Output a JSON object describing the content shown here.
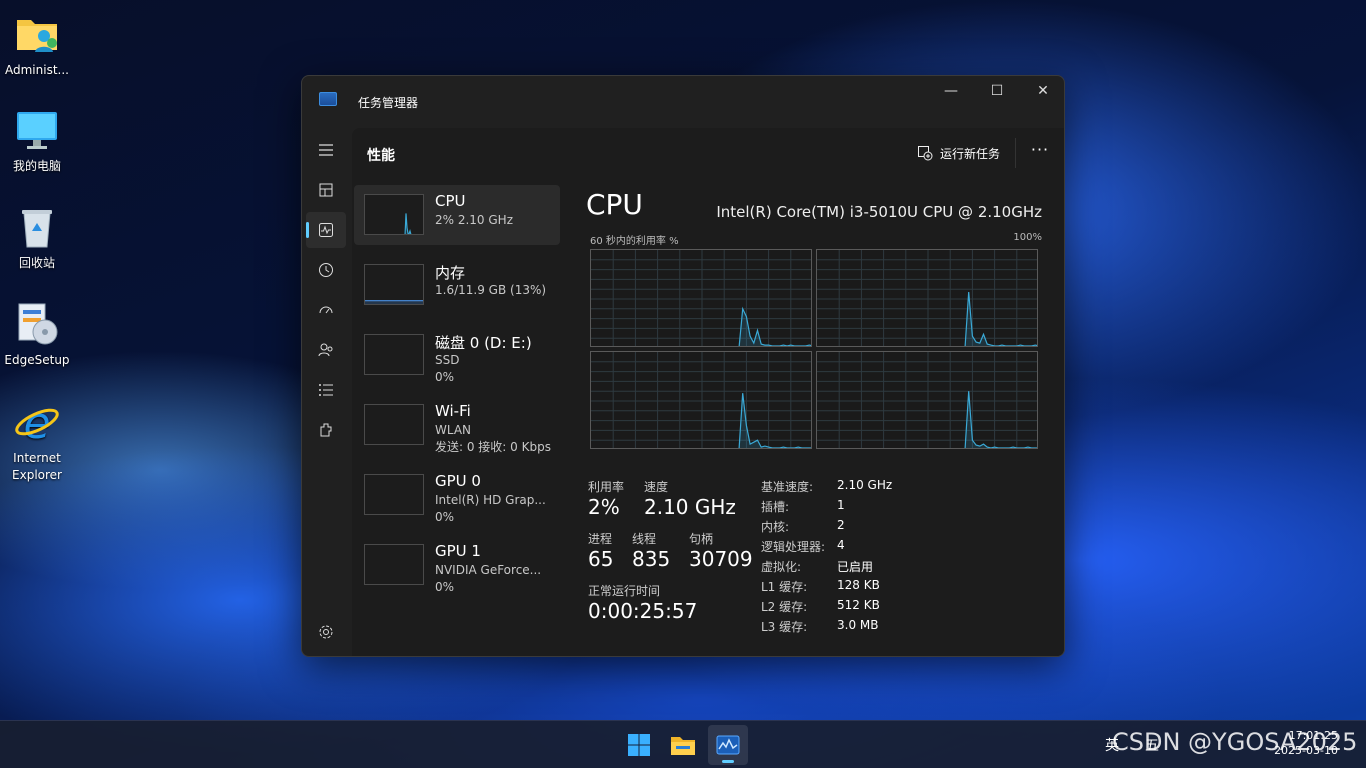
{
  "desktop": {
    "icons": [
      {
        "label": "Administ...",
        "icon": "user-folder-icon"
      },
      {
        "label": "我的电脑",
        "icon": "computer-icon"
      },
      {
        "label": "回收站",
        "icon": "recycle-bin-icon"
      },
      {
        "label": "EdgeSetup",
        "icon": "installer-icon"
      },
      {
        "label": "Internet\nExplorer",
        "icon": "internet-explorer-icon"
      }
    ]
  },
  "window": {
    "title": "任务管理器",
    "controls": {
      "minimize": "—",
      "maximize": "☐",
      "close": "✕"
    }
  },
  "nav": [
    {
      "icon": "hamburger-menu-icon"
    },
    {
      "icon": "processes-icon"
    },
    {
      "icon": "performance-icon",
      "active": true
    },
    {
      "icon": "app-history-icon"
    },
    {
      "icon": "startup-apps-icon"
    },
    {
      "icon": "users-icon"
    },
    {
      "icon": "details-icon"
    },
    {
      "icon": "services-icon"
    },
    {
      "icon": "settings-icon"
    }
  ],
  "panel": {
    "title": "性能",
    "run_task": "运行新任务",
    "more": "···"
  },
  "devices": [
    {
      "name": "CPU",
      "sub1": "2% 2.10 GHz",
      "sub2": "",
      "sub3": "",
      "selected": true
    },
    {
      "name": "内存",
      "sub1": "1.6/11.9 GB (13%)",
      "sub2": "",
      "sub3": ""
    },
    {
      "name": "磁盘 0 (D: E:)",
      "sub1": "SSD",
      "sub2": "0%",
      "sub3": ""
    },
    {
      "name": "Wi-Fi",
      "sub1": "WLAN",
      "sub2": "发送: 0 接收: 0 Kbps",
      "sub3": ""
    },
    {
      "name": "GPU 0",
      "sub1": "Intel(R) HD Grap...",
      "sub2": "0%",
      "sub3": ""
    },
    {
      "name": "GPU 1",
      "sub1": "NVIDIA GeForce...",
      "sub2": "0%",
      "sub3": ""
    }
  ],
  "cpu": {
    "heading": "CPU",
    "model": "Intel(R) Core(TM) i3-5010U CPU @ 2.10GHz",
    "graph_label": "60 秒内的利用率 %",
    "graph_max": "100%",
    "graphs": [
      {
        "name": "logical-processor-0",
        "points": [
          0,
          0,
          0,
          0,
          0,
          0,
          0,
          0,
          0,
          0,
          0,
          0,
          0,
          0,
          0,
          0,
          0,
          0,
          0,
          0,
          0,
          0,
          0,
          0,
          0,
          0,
          0,
          0,
          0,
          0,
          0,
          0,
          0,
          0,
          0,
          0,
          0,
          0,
          0,
          0,
          0,
          0,
          0,
          0,
          0,
          0,
          0,
          0,
          0,
          0,
          0,
          0,
          0,
          0,
          0,
          0,
          0,
          0,
          0,
          0,
          0,
          0,
          0,
          0,
          0,
          0,
          0,
          0,
          0,
          0,
          0,
          0,
          0,
          0,
          0,
          0,
          0,
          0,
          0,
          0,
          0,
          0,
          0,
          0,
          0,
          0,
          0,
          0,
          0,
          0,
          0,
          0,
          0,
          0,
          0,
          0,
          0,
          0,
          0,
          0,
          0,
          0,
          0,
          0,
          0,
          0,
          0,
          0,
          0,
          0,
          0,
          0,
          0,
          0,
          0,
          0,
          0,
          0,
          0,
          0,
          0,
          0,
          0,
          0,
          0,
          0,
          0,
          0,
          0,
          0,
          0,
          0,
          0,
          0,
          0,
          0,
          0,
          0,
          0,
          0,
          0,
          0,
          0,
          0,
          0,
          0,
          0,
          0,
          0,
          0,
          0,
          0,
          0,
          0,
          0,
          0,
          0,
          0,
          0,
          0,
          0,
          0,
          0,
          0,
          0,
          0,
          0,
          0,
          0,
          0,
          0,
          0,
          0,
          0,
          0,
          0,
          0,
          0,
          0,
          0,
          0,
          0,
          0,
          0,
          0,
          0,
          0,
          0,
          0,
          0,
          0,
          0,
          0,
          0,
          0,
          0,
          0,
          0,
          0,
          0,
          0,
          0,
          0,
          0,
          0,
          0,
          0,
          0,
          0,
          0,
          0,
          0,
          0,
          0,
          0,
          0,
          0,
          0,
          0,
          0,
          0,
          0,
          0,
          0,
          0,
          0
        ]
      },
      {
        "name": "logical-processor-1"
      },
      {
        "name": "logical-processor-2"
      },
      {
        "name": "logical-processor-3"
      }
    ],
    "series": [
      [
        0,
        0,
        0,
        0,
        0,
        0,
        0,
        0,
        0,
        0,
        0,
        0,
        0,
        0,
        0,
        0,
        0,
        0,
        0,
        0,
        0,
        0,
        0,
        0,
        0,
        0,
        0,
        0,
        0,
        0,
        0,
        0,
        0,
        0,
        0,
        0,
        0,
        0,
        0,
        0,
        0,
        40,
        32,
        12,
        5,
        18,
        4,
        3,
        3,
        2,
        2,
        2,
        3,
        2,
        3,
        2,
        2,
        2,
        2,
        3,
        2
      ],
      [
        0,
        0,
        0,
        0,
        0,
        0,
        0,
        0,
        0,
        0,
        0,
        0,
        0,
        0,
        0,
        0,
        0,
        0,
        0,
        0,
        0,
        0,
        0,
        0,
        0,
        0,
        0,
        0,
        0,
        0,
        0,
        0,
        0,
        0,
        0,
        0,
        0,
        0,
        0,
        0,
        0,
        57,
        12,
        6,
        5,
        14,
        4,
        3,
        2,
        2,
        3,
        2,
        2,
        2,
        2,
        3,
        2,
        2,
        2,
        3,
        2
      ],
      [
        0,
        0,
        0,
        0,
        0,
        0,
        0,
        0,
        0,
        0,
        0,
        0,
        0,
        0,
        0,
        0,
        0,
        0,
        0,
        0,
        0,
        0,
        0,
        0,
        0,
        0,
        0,
        0,
        0,
        0,
        0,
        0,
        0,
        0,
        0,
        0,
        0,
        0,
        0,
        0,
        0,
        58,
        25,
        6,
        8,
        10,
        3,
        4,
        3,
        2,
        2,
        2,
        3,
        2,
        2,
        2,
        3,
        2,
        2,
        2,
        2
      ],
      [
        0,
        0,
        0,
        0,
        0,
        0,
        0,
        0,
        0,
        0,
        0,
        0,
        0,
        0,
        0,
        0,
        0,
        0,
        0,
        0,
        0,
        0,
        0,
        0,
        0,
        0,
        0,
        0,
        0,
        0,
        0,
        0,
        0,
        0,
        0,
        0,
        0,
        0,
        0,
        0,
        0,
        60,
        10,
        5,
        4,
        6,
        3,
        2,
        3,
        2,
        2,
        2,
        2,
        3,
        2,
        2,
        2,
        3,
        2,
        2,
        2
      ]
    ],
    "stats": {
      "util_label": "利用率",
      "util_value": "2%",
      "speed_label": "速度",
      "speed_value": "2.10 GHz",
      "proc_label": "进程",
      "proc_value": "65",
      "thread_label": "线程",
      "thread_value": "835",
      "handle_label": "句柄",
      "handle_value": "30709",
      "uptime_label": "正常运行时间",
      "uptime_value": "0:00:25:57"
    },
    "specs": [
      {
        "k": "基准速度:",
        "v": "2.10 GHz"
      },
      {
        "k": "插槽:",
        "v": "1"
      },
      {
        "k": "内核:",
        "v": "2"
      },
      {
        "k": "逻辑处理器:",
        "v": "4"
      },
      {
        "k": "虚拟化:",
        "v": "已启用"
      },
      {
        "k": "L1 缓存:",
        "v": "128 KB"
      },
      {
        "k": "L2 缓存:",
        "v": "512 KB"
      },
      {
        "k": "L3 缓存:",
        "v": "3.0 MB"
      }
    ]
  },
  "thumbs": {
    "cpu": [
      0,
      0,
      0,
      0,
      0,
      0,
      0,
      0,
      0,
      0,
      0,
      0,
      0,
      0,
      0,
      0,
      0,
      0,
      0,
      0,
      0,
      0,
      0,
      0,
      0,
      0,
      0,
      0,
      0,
      0,
      0,
      0,
      0,
      0,
      0,
      0,
      0,
      0,
      0,
      0,
      0,
      55,
      20,
      6,
      5,
      12,
      3,
      2,
      3,
      2,
      2,
      2,
      3,
      2,
      2,
      2,
      3,
      2,
      2,
      2,
      2
    ],
    "memory_percent": 13
  },
  "taskbar": {
    "apps": [
      {
        "icon": "windows-start-icon"
      },
      {
        "icon": "file-explorer-icon"
      },
      {
        "icon": "task-manager-icon",
        "active": true
      }
    ],
    "ime": "英",
    "ime2": "五",
    "time": "17:01:25",
    "date": "2025-03-10",
    "watermark": "CSDN @YGOSA2025"
  },
  "colors": {
    "accent": "#60cdff",
    "graph_line": "#3aa9d6",
    "grid": "#2e3a40"
  }
}
